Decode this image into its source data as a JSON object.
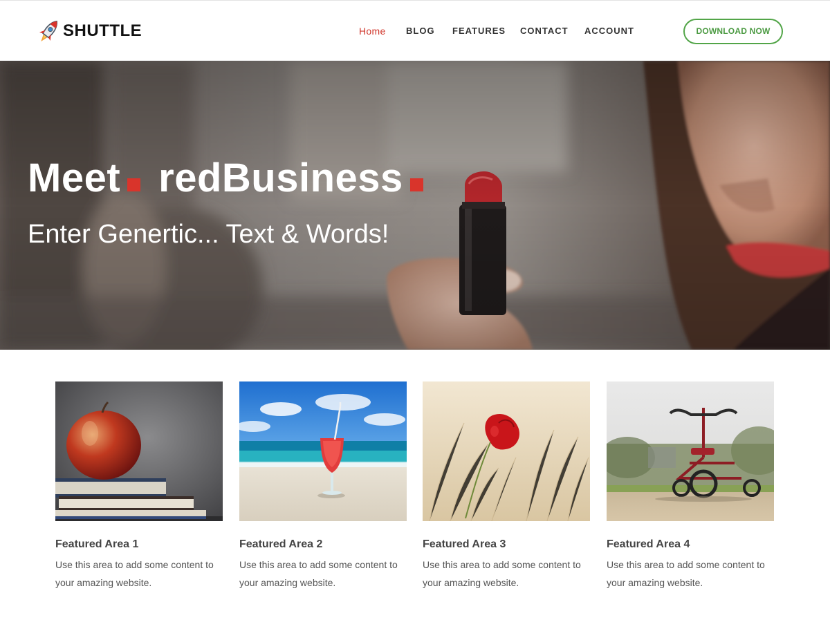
{
  "brand": {
    "name": "SHUTTLE",
    "icon": "rocket-icon"
  },
  "nav": {
    "items": [
      {
        "label": "Home",
        "active": true
      },
      {
        "label": "BLOG",
        "active": false
      },
      {
        "label": "FEATURES",
        "active": false
      },
      {
        "label": "CONTACT",
        "active": false
      },
      {
        "label": "ACCOUNT",
        "active": false
      }
    ],
    "cta_label": "DOWNLOAD NOW"
  },
  "hero": {
    "title_part1": "Meet",
    "title_part2": "redBusiness",
    "subtitle": "Enter Genertic... Text & Words!"
  },
  "features": [
    {
      "title": "Featured Area 1",
      "text": "Use this area to add some content to your amazing website.",
      "image": "apple-on-books-photo"
    },
    {
      "title": "Featured Area 2",
      "text": "Use this area to add some content to your amazing website.",
      "image": "beach-drink-photo"
    },
    {
      "title": "Featured Area 3",
      "text": "Use this area to add some content to your amazing website.",
      "image": "poppy-in-wheat-photo"
    },
    {
      "title": "Featured Area 4",
      "text": "Use this area to add some content to your amazing website.",
      "image": "red-tricycle-photo"
    }
  ],
  "colors": {
    "accent_red": "#d9342b",
    "nav_active": "#d0352a",
    "cta_green": "#52a548",
    "heading_text": "#444444",
    "body_text": "#555555"
  }
}
